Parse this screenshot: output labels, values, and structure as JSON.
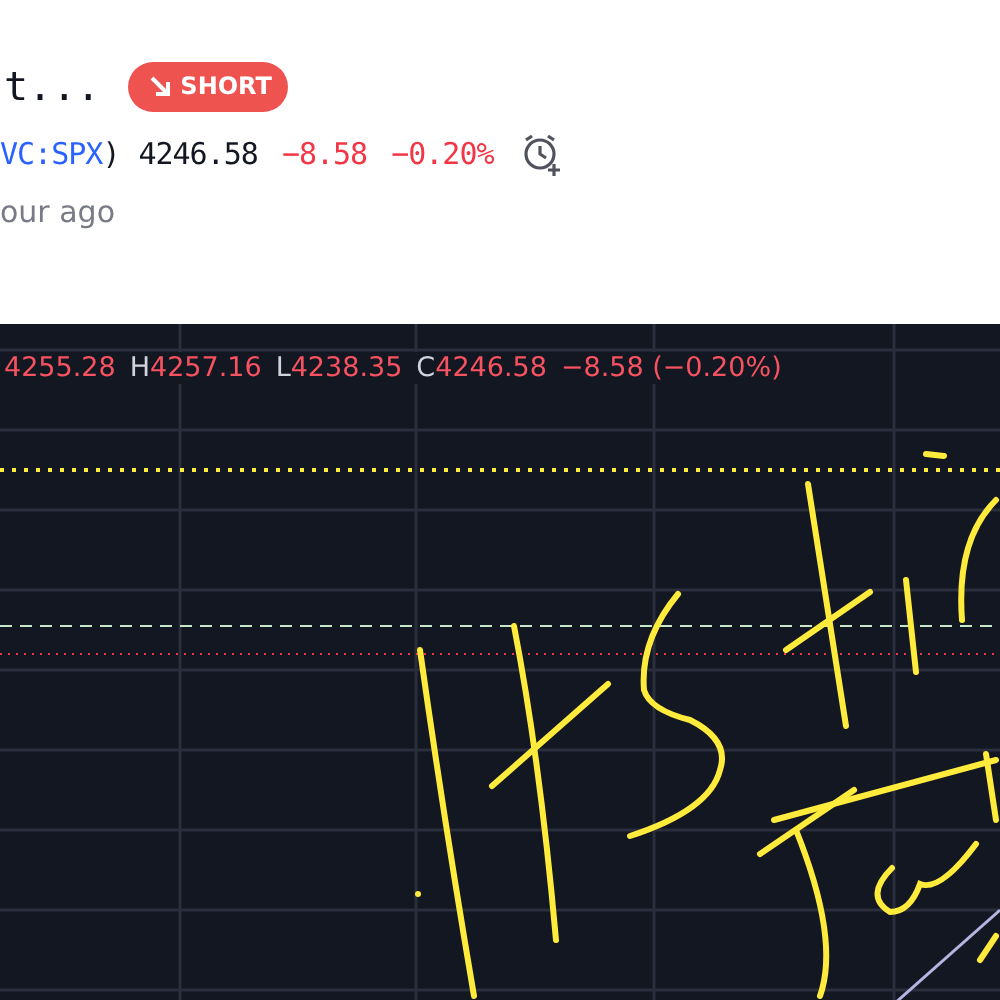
{
  "header": {
    "title": "t...",
    "badge": {
      "label": "SHORT",
      "kind": "short"
    },
    "symbol": "VC:SPX",
    "symbol_close": ")",
    "price": "4246.58",
    "change": "−8.58",
    "change_percent": "−0.20%",
    "published": "our ago"
  },
  "chart": {
    "ohlc": [
      {
        "value": "4255.28"
      },
      {
        "label": "H",
        "value": "4257.16"
      },
      {
        "label": "L",
        "value": "4238.35"
      },
      {
        "label": "C",
        "value": "4246.58"
      }
    ],
    "change": "−8.58 (−0.20%)"
  }
}
